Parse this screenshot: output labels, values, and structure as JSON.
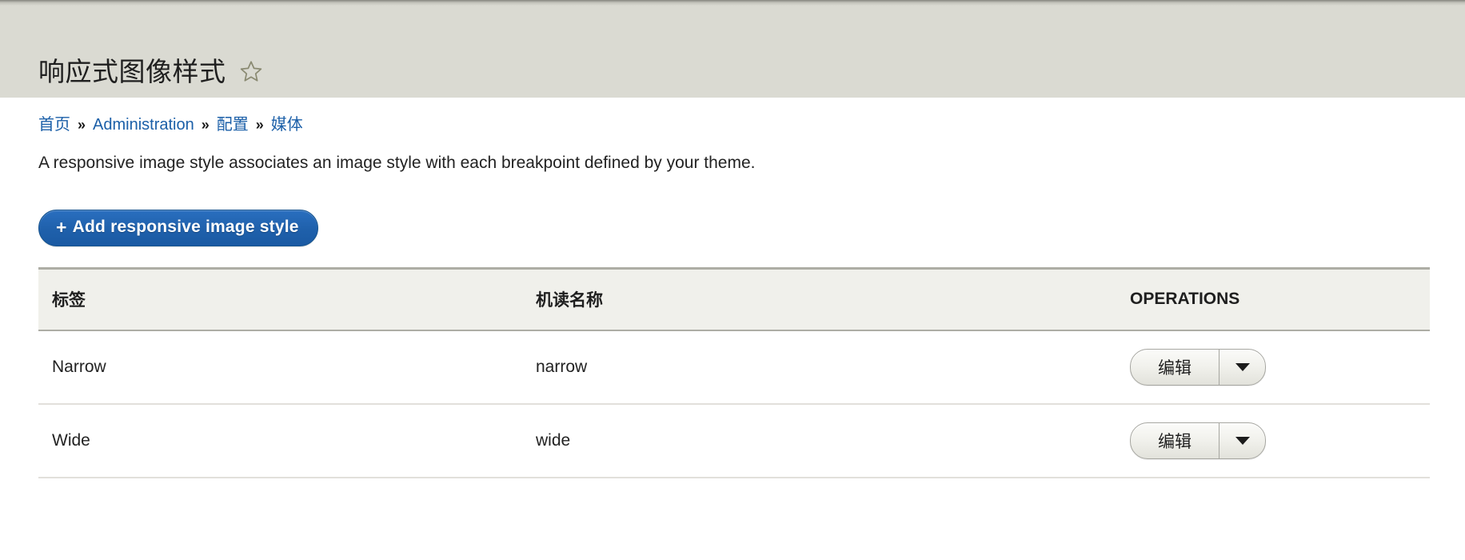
{
  "header": {
    "title": "响应式图像样式",
    "favorite_icon": "star-outline-icon"
  },
  "breadcrumb": {
    "separator": "»",
    "items": [
      {
        "label": "首页"
      },
      {
        "label": "Administration"
      },
      {
        "label": "配置"
      },
      {
        "label": "媒体"
      }
    ]
  },
  "main": {
    "description": "A responsive image style associates an image style with each breakpoint defined by your theme.",
    "add_button": {
      "plus": "+",
      "label": "Add responsive image style"
    },
    "table": {
      "columns": [
        "标签",
        "机读名称",
        "OPERATIONS"
      ],
      "rows": [
        {
          "label": "Narrow",
          "machine_name": "narrow",
          "operation": {
            "primary": "编辑",
            "toggle_icon": "chevron-down-icon"
          }
        },
        {
          "label": "Wide",
          "machine_name": "wide",
          "operation": {
            "primary": "编辑",
            "toggle_icon": "chevron-down-icon"
          }
        }
      ]
    }
  },
  "colors": {
    "header_band": "#dadad2",
    "link": "#1b5fa8",
    "primary_button": "#1f60ab",
    "table_head_bg": "#f0f0eb",
    "border": "#adada5"
  }
}
